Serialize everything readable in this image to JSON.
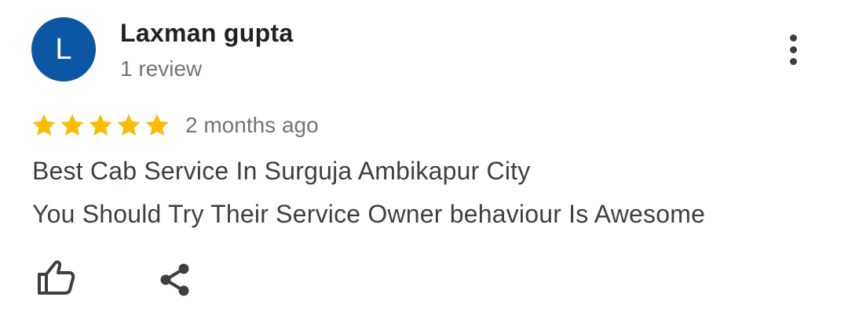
{
  "reviewer": {
    "initial": "L",
    "name": "Laxman gupta",
    "review_count": "1 review",
    "avatar_color": "#0b57a4"
  },
  "review": {
    "rating": 5,
    "max_rating": 5,
    "star_color": "#fbbc04",
    "time": "2 months ago",
    "lines": [
      "Best Cab Service In Surguja Ambikapur City",
      "You Should Try Their Service Owner behaviour Is Awesome"
    ]
  },
  "actions": {
    "more_icon": "more-vert-icon",
    "like_icon": "thumb-up-icon",
    "share_icon": "share-icon"
  }
}
